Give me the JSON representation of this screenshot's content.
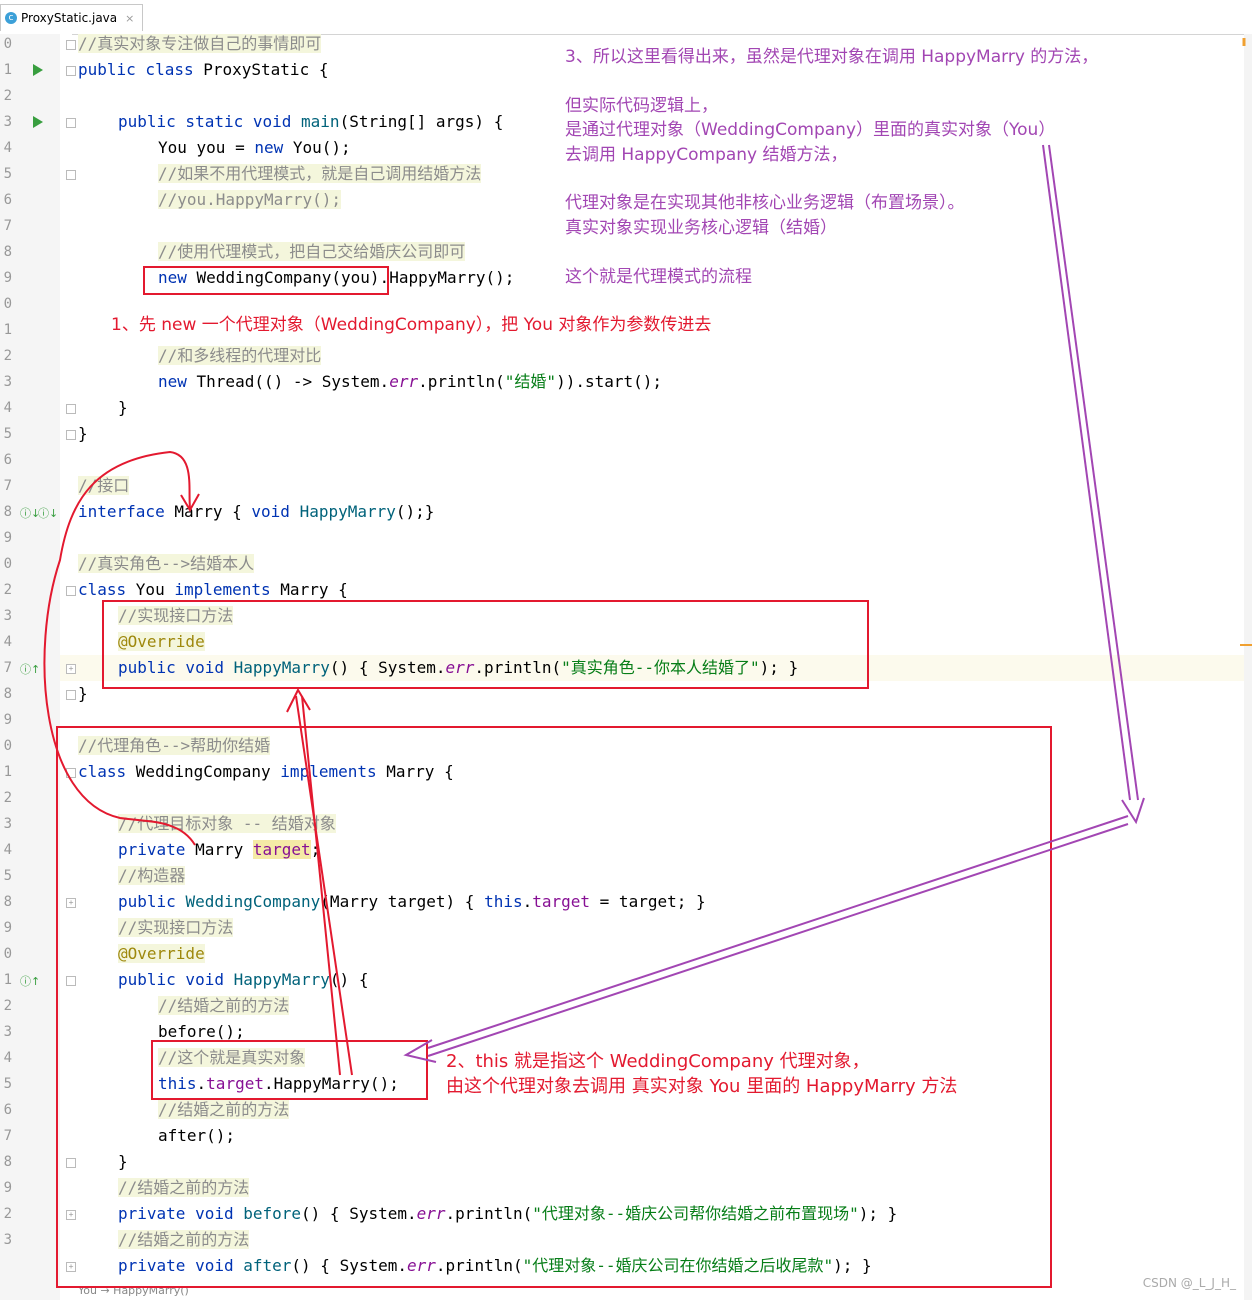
{
  "tab": {
    "filename": "ProxyStatic.java",
    "icon": "java-class-icon",
    "close": "×"
  },
  "gutter_numbers": [
    "0",
    "1",
    "2",
    "3",
    "4",
    "5",
    "6",
    "7",
    "8",
    "9",
    "0",
    "1",
    "2",
    "3",
    "4",
    "5",
    "6",
    "7",
    "8",
    "9",
    "0",
    "2",
    "3",
    "4",
    "7",
    "8",
    "9",
    "0",
    "1",
    "2",
    "3",
    "4",
    "5",
    "8",
    "9",
    "0",
    "1",
    "2",
    "3",
    "4",
    "5",
    "6",
    "7",
    "8",
    "9",
    "2",
    "3"
  ],
  "code": {
    "l1": "//真实对象专注做自己的事情即可",
    "l2a": "public class ",
    "l2b": "ProxyStatic {",
    "l4a": "public static void ",
    "l4b": "main",
    "l4c": "(String[] args) {",
    "l5a": "You you = ",
    "l5b": "new ",
    "l5c": "You();",
    "l6": "//如果不用代理模式，就是自己调用结婚方法",
    "l7": "//you.HappyMarry();",
    "l9": "//使用代理模式，把自己交给婚庆公司即可",
    "l10a": "new ",
    "l10b": "WeddingCompany(you).HappyMarry();",
    "l13": "//和多线程的代理对比",
    "l14a": "new ",
    "l14b": "Thread(() -> System.",
    "l14c": "err",
    "l14d": ".println(",
    "l14e": "\"结婚\"",
    "l14f": ")).start();",
    "l15": "}",
    "l16": "}",
    "l18": "//接口",
    "l19a": "interface ",
    "l19b": "Marry { ",
    "l19c": "void ",
    "l19d": "HappyMarry",
    "l19e": "();}",
    "l21": "//真实角色-->结婚本人",
    "l22a": "class ",
    "l22b": "You ",
    "l22c": "implements ",
    "l22d": "Marry {",
    "l23": "//实现接口方法",
    "l24": "@Override",
    "l25a": "public void ",
    "l25b": "HappyMarry",
    "l25c": "() { System.",
    "l25d": "err",
    "l25e": ".println(",
    "l25f": "\"真实角色--你本人结婚了\"",
    "l25g": "); }",
    "l26": "}",
    "l28": "//代理角色-->帮助你结婚",
    "l29a": "class ",
    "l29b": "WeddingCompany ",
    "l29c": "implements ",
    "l29d": "Marry {",
    "l31": "//代理目标对象 -- 结婚对象",
    "l32a": "private ",
    "l32b": "Marry ",
    "l32c": "target",
    "l32d": ";",
    "l33": "//构造器",
    "l34a": "public ",
    "l34b": "WeddingCompany",
    "l34c": "(Marry target) { ",
    "l34d": "this",
    "l34e": ".",
    "l34f": "target",
    "l34g": " = target; }",
    "l35": "//实现接口方法",
    "l36": "@Override",
    "l37a": "public void ",
    "l37b": "HappyMarry",
    "l37c": "() {",
    "l38": "//结婚之前的方法",
    "l39": "before();",
    "l40": "//这个就是真实对象",
    "l41a": "this",
    "l41b": ".",
    "l41c": "target",
    "l41d": ".HappyMarry();",
    "l42": "//结婚之前的方法",
    "l43": "after();",
    "l44": "}",
    "l45": "//结婚之前的方法",
    "l46a": "private void ",
    "l46b": "before",
    "l46c": "() { System.",
    "l46d": "err",
    "l46e": ".println(",
    "l46f": "\"代理对象--婚庆公司帮你结婚之前布置现场\"",
    "l46g": "); }",
    "l47": "//结婚之前的方法",
    "l48a": "private void ",
    "l48b": "after",
    "l48c": "() { System.",
    "l48d": "err",
    "l48e": ".println(",
    "l48f": "\"代理对象--婚庆公司在你结婚之后收尾款\"",
    "l48g": "); }",
    "l49": "You → HappyMarry()"
  },
  "notes": {
    "note1": "1、先 new 一个代理对象（WeddingCompany），把 You 对象作为参数传进去",
    "note2a": "2、this 就是指这个 WeddingCompany 代理对象，",
    "note2b": "由这个代理对象去调用 真实对象  You 里面的 HappyMarry 方法",
    "note3a": "3、所以这里看得出来，虽然是代理对象在调用 HappyMarry 的方法，",
    "note3b": "但实际代码逻辑上，",
    "note3c": "是通过代理对象（WeddingCompany）里面的真实对象（You）",
    "note3d": "去调用 HappyCompany 结婚方法，",
    "note3e": "代理对象是在实现其他非核心业务逻辑（布置场景）。",
    "note3f": "真实对象实现业务核心逻辑（结婚）",
    "note3g": "这个就是代理模式的流程"
  },
  "watermark": "CSDN @_L_J_H_",
  "colors": {
    "keyword": "#0033b3",
    "comment": "#8c8c8c",
    "annotation_red": "#e3192f",
    "annotation_purple": "#a246b3"
  }
}
